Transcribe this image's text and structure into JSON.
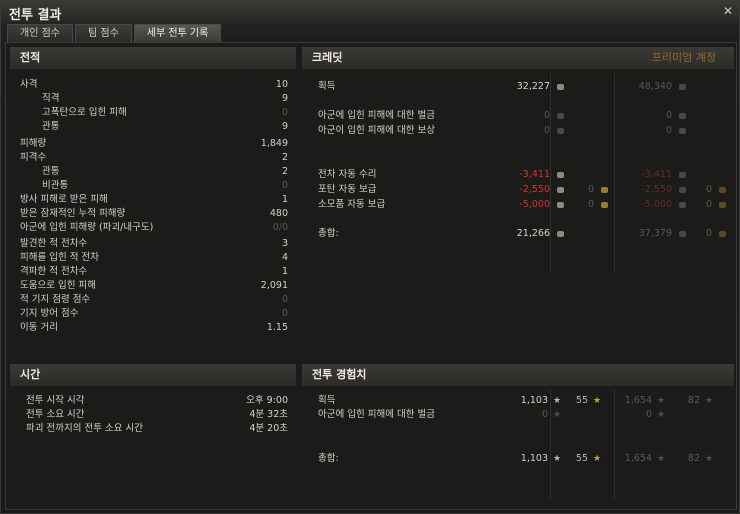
{
  "window": {
    "title": "전투 결과",
    "close_glyph": "✕"
  },
  "tabs": [
    {
      "label": "개인 점수"
    },
    {
      "label": "팀 점수"
    },
    {
      "label": "세부 전투 기록"
    }
  ],
  "battle": {
    "header": "전적",
    "rows": [
      {
        "label": "사격",
        "value": "10"
      },
      {
        "label": "직격",
        "value": "9"
      },
      {
        "label": "고폭탄으로 입힌 피해",
        "value": "0"
      },
      {
        "label": "관통",
        "value": "9"
      },
      {
        "label": "피해량",
        "value": "1,849"
      },
      {
        "label": "피격수",
        "value": "2"
      },
      {
        "label": "관통",
        "value": "2"
      },
      {
        "label": "비관통",
        "value": "0"
      },
      {
        "label": "방사 피해로 받은 피해",
        "value": "1"
      },
      {
        "label": "받은 잠재적인 누적 피해량",
        "value": "480"
      },
      {
        "label": "아군에 입힌 피해량 (파괴/내구도)",
        "value": "0/0"
      },
      {
        "label": "발견한 적 전차수",
        "value": "3"
      },
      {
        "label": "피해를 입힌 적 전차",
        "value": "4"
      },
      {
        "label": "격파한 적 전차수",
        "value": "1"
      },
      {
        "label": "도움으로 입힌 피해",
        "value": "2,091"
      },
      {
        "label": "적 기지 점령 점수",
        "value": "0"
      },
      {
        "label": "기지 방어 점수",
        "value": "0"
      },
      {
        "label": "이동 거리",
        "value": "1.15"
      }
    ]
  },
  "credits": {
    "header": "크레딧",
    "premium_label": "프리미엄 계정",
    "rows": [
      {
        "label": "획득",
        "c1": "32,227",
        "c2": "",
        "p1": "48,340",
        "p2": ""
      },
      {
        "label": "아군에 입힌 피해에 대한 벌금",
        "c1": "0",
        "c2": "",
        "p1": "0",
        "p2": ""
      },
      {
        "label": "아군이 입힌 피해에 대한 보상",
        "c1": "0",
        "c2": "",
        "p1": "0",
        "p2": ""
      },
      {
        "label": "전차 자동 수리",
        "c1": "-3,411",
        "c2": "",
        "p1": "-3,411",
        "p2": ""
      },
      {
        "label": "포탄 자동 보급",
        "c1": "-2,550",
        "c2": "0",
        "p1": "-2,550",
        "p2": "0"
      },
      {
        "label": "소모품 자동 보급",
        "c1": "-5,000",
        "c2": "0",
        "p1": "-5,000",
        "p2": "0"
      },
      {
        "label": "총합:",
        "c1": "21,266",
        "c2": "",
        "p1": "37,379",
        "p2": "0"
      }
    ]
  },
  "time": {
    "header": "시간",
    "rows": [
      {
        "label": "전투 시작 시각",
        "value": "오후 9:00"
      },
      {
        "label": "전투 소요 시간",
        "value": "4분 32초"
      },
      {
        "label": "파괴 전까지의 전투 소요 시간",
        "value": "4분 20초"
      }
    ]
  },
  "xp": {
    "header": "전투 경험치",
    "rows": [
      {
        "label": "획득",
        "c1": "1,103",
        "c2": "55",
        "p1": "1,654",
        "p2": "82"
      },
      {
        "label": "아군에 입힌 피해에 대한 벌금",
        "c1": "0",
        "c2": "",
        "p1": "0",
        "p2": ""
      },
      {
        "label": "총합:",
        "c1": "1,103",
        "c2": "55",
        "p1": "1,654",
        "p2": "82"
      }
    ]
  },
  "colors": {
    "accent": "#8c6a30",
    "negative": "#d8322a",
    "text": "#d6d2c4"
  }
}
